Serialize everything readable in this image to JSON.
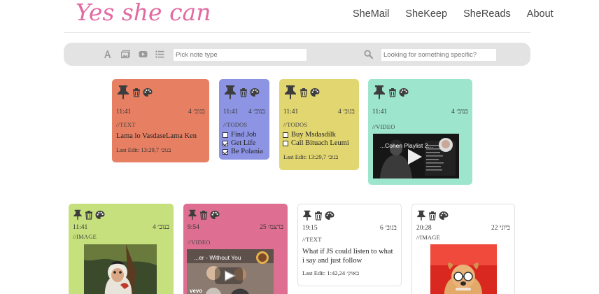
{
  "brand": {
    "logo": "Yes she can"
  },
  "nav": [
    {
      "label": "SheMail"
    },
    {
      "label": "SheKeep"
    },
    {
      "label": "SheReads"
    },
    {
      "label": "About"
    }
  ],
  "toolbar": {
    "type_filter_placeholder": "Pick note type",
    "search_placeholder": "Looking for something specific?",
    "icons": [
      "text-type-icon",
      "image-type-icon",
      "video-type-icon",
      "list-type-icon",
      "search-icon"
    ]
  },
  "colors": {
    "orange": "#e77f63",
    "blue": "#8c94e3",
    "yellow": "#e2d670",
    "teal": "#9de5cd",
    "green": "#c6e07d",
    "pink": "#de6f92",
    "white": "#ffffff",
    "logo": "#e26aa2"
  },
  "notes": [
    {
      "time": "11:41",
      "date": "בנוב׳ 4",
      "type": "//TEXT",
      "text": "Lama lo VasdaseLama Ken",
      "edit": "Last Edit: 13:29,7 בנוב׳"
    },
    {
      "time": "11:41",
      "date": "בנוב׳ 4",
      "type": "//TODOS",
      "todos": [
        {
          "label": "Find Job",
          "done": false
        },
        {
          "label": "Get Life",
          "done": true
        },
        {
          "label": "Be Polania",
          "done": true
        }
      ]
    },
    {
      "time": "11:41",
      "date": "בנוב׳ 4",
      "type": "//TODOS",
      "todos": [
        {
          "label": "Buy Msdasdilk",
          "done": false
        },
        {
          "label": "Call Bituach Leumi",
          "done": false
        }
      ],
      "edit": "Last Edit: 13:29,7 בנוב׳"
    },
    {
      "time": "11:41",
      "date": "בנוב׳ 4",
      "type": "//VIDEO",
      "video_title": "...Cohen Playlist 2..."
    },
    {
      "time": "11:41",
      "date": "בנוב׳ 4",
      "type": "//IMAGE"
    },
    {
      "time": "9:54",
      "date": "בדצמ׳ 25",
      "type": "//VIDEO",
      "video_title": "...er - Without You",
      "video_brand": "vevo"
    },
    {
      "time": "19:15",
      "date": "בנוב׳ 6",
      "type": "//TEXT",
      "text": "What if JS could listen to what i say and just follow",
      "edit": "Last Edit: 1:42,24 באוק׳"
    },
    {
      "time": "20:28",
      "date": "ביוני 22",
      "type": "//IMAGE"
    }
  ]
}
